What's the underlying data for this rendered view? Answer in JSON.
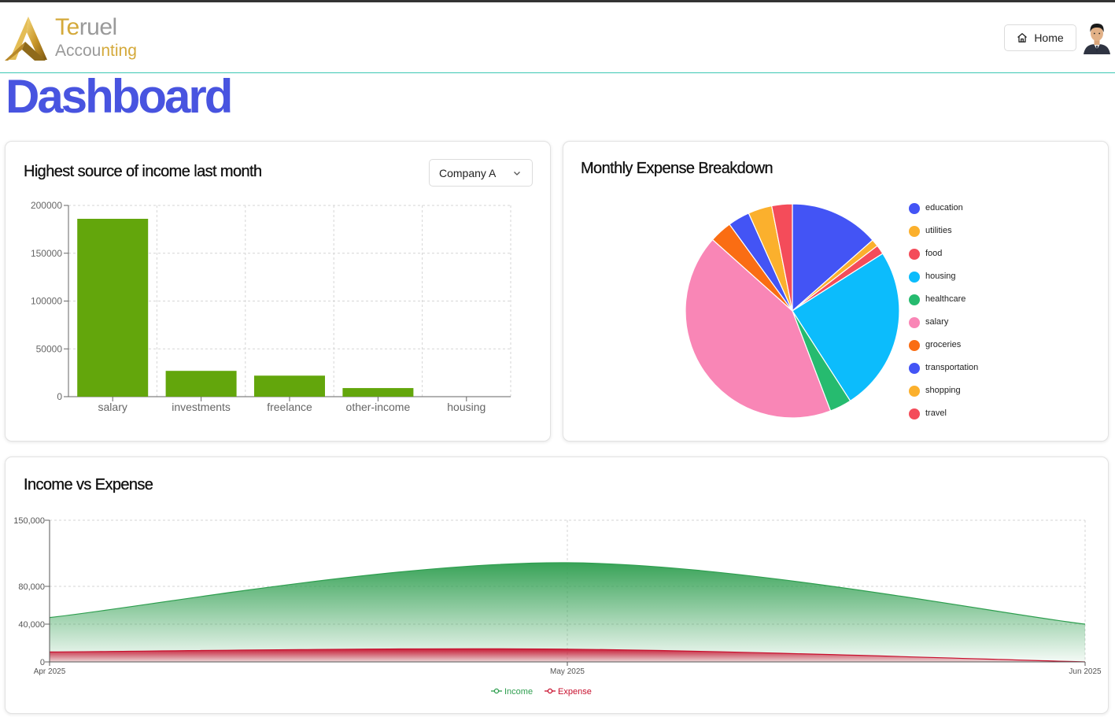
{
  "app": {
    "brand_line1_a": "Te",
    "brand_line1_b": "ruel",
    "brand_line2_a": "Accou",
    "brand_line2_b": "nting",
    "home_label": "Home",
    "page_title": "Dashboard"
  },
  "colors": {
    "title_blue": "#4854e0",
    "income_green": "#2e9e4f",
    "expense_red": "#c8102e",
    "bar_green": "#63a60c"
  },
  "income_card": {
    "title": "Highest source of income last month",
    "company_select": {
      "value": "Company A"
    }
  },
  "expense_card": {
    "title": "Monthly Expense Breakdown"
  },
  "trend_card": {
    "title": "Income vs Expense"
  },
  "chart_data": [
    {
      "type": "bar",
      "categories": [
        "salary",
        "investments",
        "freelance",
        "other-income",
        "housing"
      ],
      "values": [
        186000,
        27000,
        22000,
        9000,
        0
      ],
      "ylim": [
        0,
        200000
      ],
      "yticks": [
        0,
        50000,
        100000,
        150000,
        200000
      ],
      "color": "#63a60c",
      "grid": true
    },
    {
      "type": "pie",
      "legend_position": "right",
      "slices": [
        {
          "label": "education",
          "value": 13.5,
          "color": "#4354f5"
        },
        {
          "label": "utilities",
          "value": 1.1,
          "color": "#fbb02d"
        },
        {
          "label": "food",
          "value": 1.4,
          "color": "#f44c5a"
        },
        {
          "label": "housing",
          "value": 24.9,
          "color": "#0cbcfc"
        },
        {
          "label": "healthcare",
          "value": 3.3,
          "color": "#26bb6f"
        },
        {
          "label": "salary",
          "value": 42.4,
          "color": "#f986b6"
        },
        {
          "label": "groceries",
          "value": 3.4,
          "color": "#fa6d13"
        },
        {
          "label": "transportation",
          "value": 3.3,
          "color": "#4354f5"
        },
        {
          "label": "shopping",
          "value": 3.6,
          "color": "#fbb02d"
        },
        {
          "label": "travel",
          "value": 3.1,
          "color": "#f44c5a"
        }
      ]
    },
    {
      "type": "area",
      "x": [
        "Apr 2025",
        "May 2025",
        "Jun 2025"
      ],
      "yticks": [
        0,
        40000,
        80000,
        150000
      ],
      "ytick_labels": [
        "0",
        "40,000",
        "80,000",
        "150,000"
      ],
      "ylim": [
        0,
        150000
      ],
      "grid": true,
      "legend_position": "bottom",
      "series": [
        {
          "name": "Income",
          "values": [
            47000,
            105000,
            40000
          ],
          "color": "#2e9e4f"
        },
        {
          "name": "Expense",
          "values": [
            10500,
            13500,
            0
          ],
          "color": "#c8102e"
        }
      ]
    }
  ]
}
